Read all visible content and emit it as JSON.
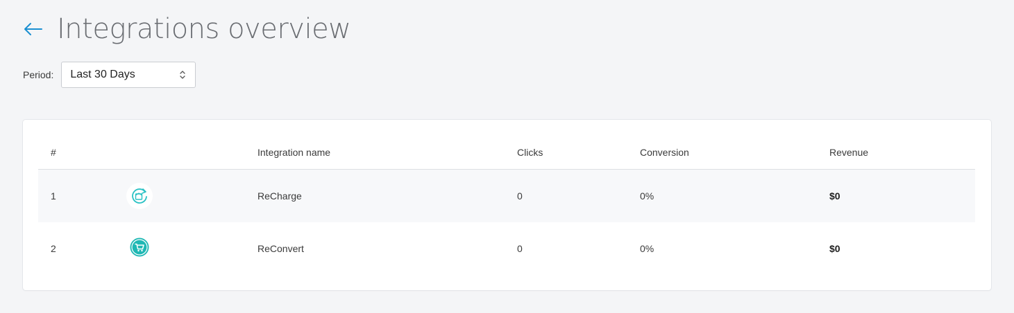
{
  "page": {
    "title": "Integrations overview",
    "accent_color": "#1a8fd1"
  },
  "period": {
    "label": "Period:",
    "selected": "Last 30 Days"
  },
  "table": {
    "headers": {
      "number": "#",
      "icon": "",
      "name": "Integration name",
      "clicks": "Clicks",
      "conversion": "Conversion",
      "revenue": "Revenue"
    },
    "rows": [
      {
        "number": "1",
        "icon": "recharge-logo-icon",
        "name": "ReCharge",
        "clicks": "0",
        "conversion": "0%",
        "revenue": "$0"
      },
      {
        "number": "2",
        "icon": "reconvert-logo-icon",
        "name": "ReConvert",
        "clicks": "0",
        "conversion": "0%",
        "revenue": "$0"
      }
    ]
  }
}
